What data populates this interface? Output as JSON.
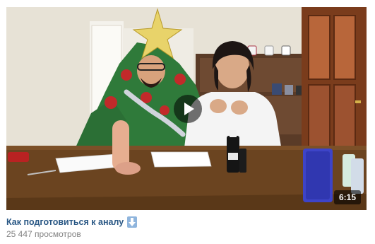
{
  "video": {
    "title": "Как подготовиться к аналу",
    "views": "25 447 просмотров",
    "duration": "6:15",
    "title_emoji_icon": "arrow-down-icon",
    "link_color": "#2a5885",
    "meta_color": "#828282"
  },
  "thumbnail": {
    "icon": "play-icon"
  }
}
